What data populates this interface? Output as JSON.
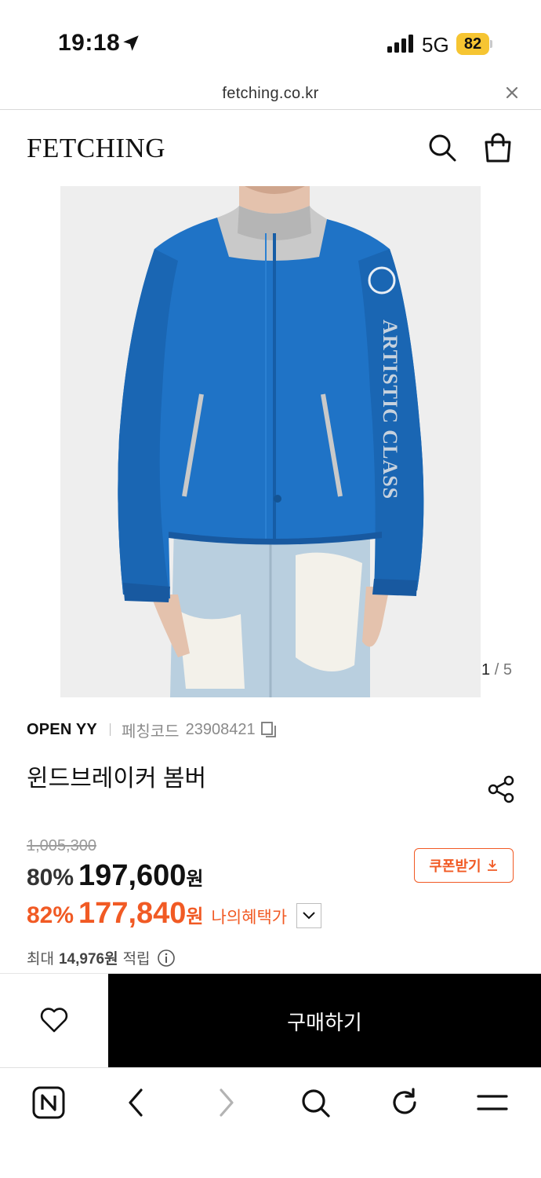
{
  "status_bar": {
    "time": "19:18",
    "network": "5G",
    "battery": "82"
  },
  "browser": {
    "url": "fetching.co.kr"
  },
  "header": {
    "logo": "FETCHING"
  },
  "gallery": {
    "current": "1",
    "separator": "/",
    "total": "5"
  },
  "product": {
    "brand": "OPEN YY",
    "code_label": "페칭코드",
    "code": "23908421",
    "title": "윈드브레이커 봄버",
    "original_price": "1,005,300",
    "discount_rate": "80%",
    "price": "197,600",
    "currency": "원",
    "benefit_rate": "82%",
    "benefit_price": "177,840",
    "benefit_label": "나의혜택가",
    "coupon_label": "쿠폰받기",
    "points_prefix": "최대",
    "points_value": "14,976원",
    "points_suffix": "적립"
  },
  "actions": {
    "buy_label": "구매하기"
  },
  "colors": {
    "accent": "#f15a24",
    "jacket": "#1f73c6",
    "buy_button": "#000000"
  },
  "icons": [
    "location-arrow-icon",
    "signal-icon",
    "close-icon",
    "search-icon",
    "shopping-bag-icon",
    "copy-icon",
    "share-icon",
    "chevron-down-icon",
    "download-icon",
    "info-icon",
    "heart-icon",
    "naver-icon",
    "back-icon",
    "forward-icon",
    "refresh-icon",
    "menu-icon"
  ]
}
